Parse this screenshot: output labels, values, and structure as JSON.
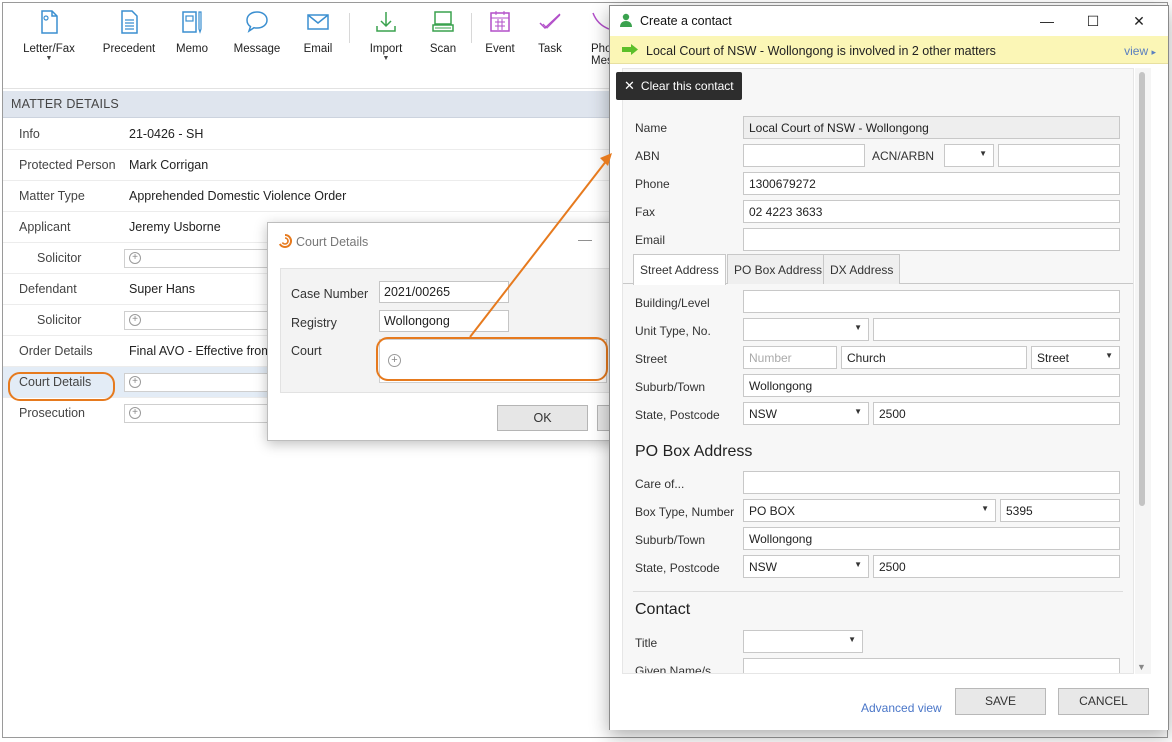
{
  "ribbon": {
    "buttons": [
      {
        "label": "Letter/Fax",
        "icon": "letter-fax-icon",
        "dropdown": true
      },
      {
        "label": "Precedent",
        "icon": "precedent-icon"
      },
      {
        "label": "Memo",
        "icon": "memo-icon"
      },
      {
        "label": "Message",
        "icon": "message-icon"
      },
      {
        "label": "Email",
        "icon": "email-icon"
      },
      {
        "label": "Import",
        "icon": "import-icon",
        "dropdown": true
      },
      {
        "label": "Scan",
        "icon": "scan-icon"
      },
      {
        "label": "Event",
        "icon": "event-icon"
      },
      {
        "label": "Task",
        "icon": "task-icon"
      },
      {
        "label": "Pho",
        "icon": "phone-message-icon"
      }
    ],
    "overflow_label": "Mess",
    "accent_colors": {
      "blue": "#3b8fd0",
      "green": "#3aa24e",
      "purple": "#b24fc9"
    }
  },
  "matter": {
    "header": "MATTER DETAILS",
    "rows": [
      {
        "label": "Info",
        "value": "21-0426 - SH"
      },
      {
        "label": "Protected Person",
        "value": "Mark Corrigan"
      },
      {
        "label": "Matter Type",
        "value": "Apprehended Domestic Violence Order"
      },
      {
        "label": "Applicant",
        "value": "Jeremy Usborne"
      },
      {
        "label": "Solicitor",
        "value": ""
      },
      {
        "label": "Defendant",
        "value": "Super Hans"
      },
      {
        "label": "Solicitor",
        "value": ""
      },
      {
        "label": "Order Details",
        "value": "Final AVO - Effective from"
      },
      {
        "label": "Court Details",
        "value": ""
      },
      {
        "label": "Prosecution",
        "value": ""
      }
    ]
  },
  "court_dialog": {
    "title": "Court Details",
    "case_number_label": "Case Number",
    "case_number": "2021/00265",
    "registry_label": "Registry",
    "registry": "Wollongong",
    "court_label": "Court",
    "ok": "OK"
  },
  "contact": {
    "title": "Create a contact",
    "banner": "Local Court of NSW - Wollongong is involved in 2 other matters",
    "banner_link": "view",
    "clear": "Clear this contact",
    "name_label": "Name",
    "name": "Local Court of NSW - Wollongong",
    "abn_label": "ABN",
    "acn_label": "ACN/ARBN",
    "phone_label": "Phone",
    "phone": "1300679272",
    "fax_label": "Fax",
    "fax": "02 4223 3633",
    "email_label": "Email",
    "tabs": [
      "Street Address",
      "PO Box Address",
      "DX Address"
    ],
    "street": {
      "building_label": "Building/Level",
      "unit_label": "Unit Type, No.",
      "street_label": "Street",
      "street_number_placeholder": "Number",
      "street_name": "Church",
      "street_type": "Street",
      "suburb_label": "Suburb/Town",
      "suburb": "Wollongong",
      "state_label": "State, Postcode",
      "state": "NSW",
      "postcode": "2500"
    },
    "po_heading": "PO Box Address",
    "po": {
      "care_label": "Care of...",
      "box_label": "Box Type, Number",
      "box_type": "PO BOX",
      "box_number": "5395",
      "suburb_label": "Suburb/Town",
      "suburb": "Wollongong",
      "state_label": "State, Postcode",
      "state": "NSW",
      "postcode": "2500"
    },
    "contact_heading": "Contact",
    "title_label": "Title",
    "given_label": "Given Name/s",
    "advanced": "Advanced view",
    "save": "SAVE",
    "cancel": "CANCEL"
  }
}
